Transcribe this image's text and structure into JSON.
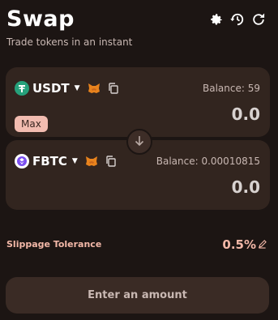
{
  "header": {
    "title": "Swap",
    "subtitle": "Trade tokens in an instant",
    "icons": [
      "gear-icon",
      "history-icon",
      "refresh-icon"
    ]
  },
  "from_card": {
    "token_symbol": "USDT",
    "token_icon": "tether-logo",
    "balance_label": "Balance: 59",
    "amount": "0.0",
    "max_label": "Max"
  },
  "to_card": {
    "token_symbol": "FBTC",
    "token_icon": "fbtc-logo",
    "balance_label": "Balance: 0.00010815",
    "amount": "0.0"
  },
  "slippage": {
    "label": "Slippage Tolerance",
    "value": "0.5%"
  },
  "cta": {
    "label": "Enter an amount"
  },
  "colors": {
    "background": "#1c1513",
    "card": "#32251f",
    "accent": "#f3b8a8",
    "max_bg": "#f2bcb0",
    "tether_green": "#26a17b",
    "fox_orange": "#e8831d"
  }
}
